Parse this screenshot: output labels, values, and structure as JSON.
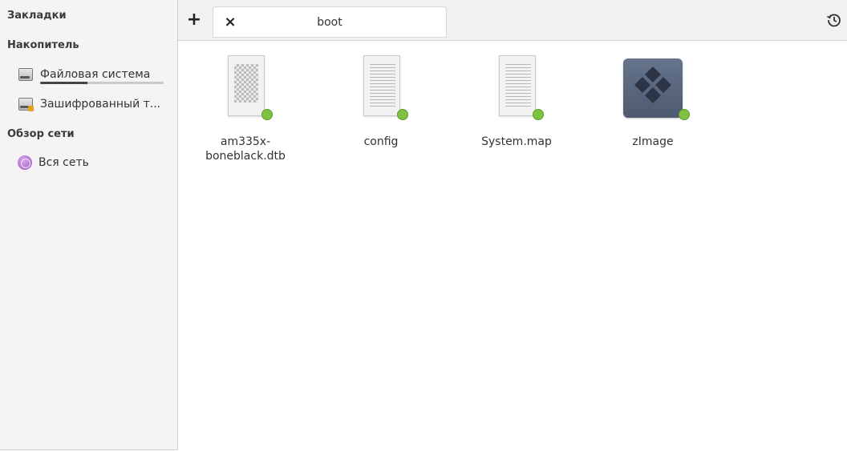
{
  "sidebar": {
    "bookmarks_header": "Закладки",
    "storage_header": "Накопитель",
    "storage_items": [
      {
        "label": "Файловая система",
        "icon": "drive-icon",
        "usage_fraction": 0.38
      },
      {
        "label": "Зашифрованный т...",
        "icon": "encrypted-drive-icon"
      }
    ],
    "network_header": "Обзор сети",
    "network_items": [
      {
        "label": "Вся сеть",
        "icon": "network-icon"
      }
    ]
  },
  "toolbar": {
    "new_tab_icon": "+",
    "close_tab_icon": "×",
    "tab_title": "boot",
    "history_icon": "history-icon"
  },
  "files": [
    {
      "name": "am335x-\nboneblack.dtb",
      "icon": "binary-file-icon"
    },
    {
      "name": "config",
      "icon": "text-file-icon"
    },
    {
      "name": "System.map",
      "icon": "text-file-icon"
    },
    {
      "name": "zImage",
      "icon": "executable-icon"
    }
  ],
  "colors": {
    "sidebar_bg": "#f4f4f4",
    "toolbar_bg": "#f1f1f1",
    "badge_green": "#7fc241",
    "app_tile": "#5a677e"
  }
}
